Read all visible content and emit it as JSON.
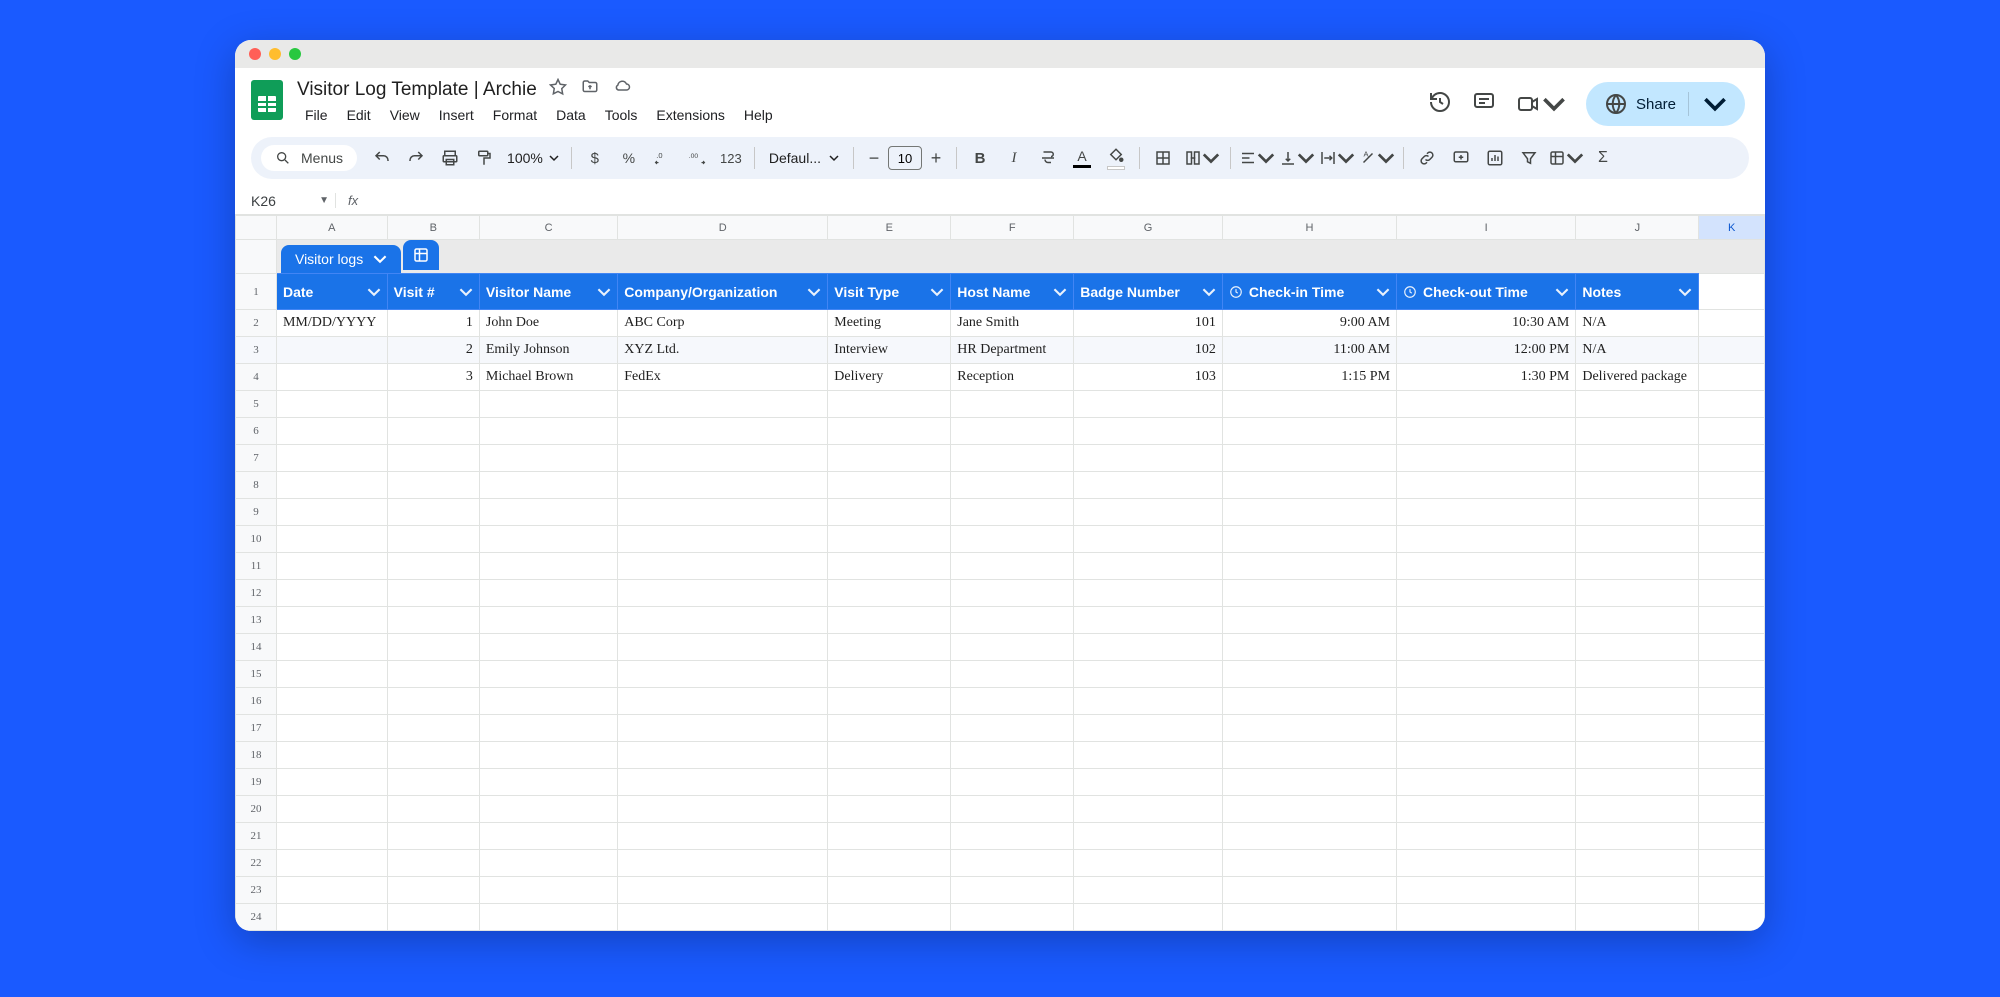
{
  "doc": {
    "title": "Visitor Log Template | Archie"
  },
  "menu": {
    "file": "File",
    "edit": "Edit",
    "view": "View",
    "insert": "Insert",
    "format": "Format",
    "data": "Data",
    "tools": "Tools",
    "extensions": "Extensions",
    "help": "Help"
  },
  "share": {
    "label": "Share"
  },
  "toolbar": {
    "menus_label": "Menus",
    "zoom": "100%",
    "font": "Defaul...",
    "font_size": "10",
    "number_fmt": "123"
  },
  "namebox": {
    "cell": "K26"
  },
  "columns": [
    "A",
    "B",
    "C",
    "D",
    "E",
    "F",
    "G",
    "H",
    "I",
    "J",
    "K"
  ],
  "selected_column": "K",
  "tab_name": "Visitor logs",
  "table_headers": {
    "date": "Date",
    "visit_no": "Visit #",
    "visitor": "Visitor Name",
    "company": "Company/Organization",
    "visit_type": "Visit Type",
    "host": "Host Name",
    "badge": "Badge Number",
    "checkin": "Check-in Time",
    "checkout": "Check-out Time",
    "notes": "Notes"
  },
  "rows": [
    {
      "date": "MM/DD/YYYY",
      "visit_no": "1",
      "visitor": "John Doe",
      "company": "ABC Corp",
      "visit_type": "Meeting",
      "host": "Jane Smith",
      "badge": "101",
      "checkin": "9:00 AM",
      "checkout": "10:30 AM",
      "notes": "N/A"
    },
    {
      "date": "",
      "visit_no": "2",
      "visitor": "Emily Johnson",
      "company": "XYZ Ltd.",
      "visit_type": "Interview",
      "host": "HR Department",
      "badge": "102",
      "checkin": "11:00 AM",
      "checkout": "12:00 PM",
      "notes": "N/A"
    },
    {
      "date": "",
      "visit_no": "3",
      "visitor": "Michael Brown",
      "company": "FedEx",
      "visit_type": "Delivery",
      "host": "Reception",
      "badge": "103",
      "checkin": "1:15 PM",
      "checkout": "1:30 PM",
      "notes": "Delivered package"
    }
  ],
  "row_numbers_total": 24
}
